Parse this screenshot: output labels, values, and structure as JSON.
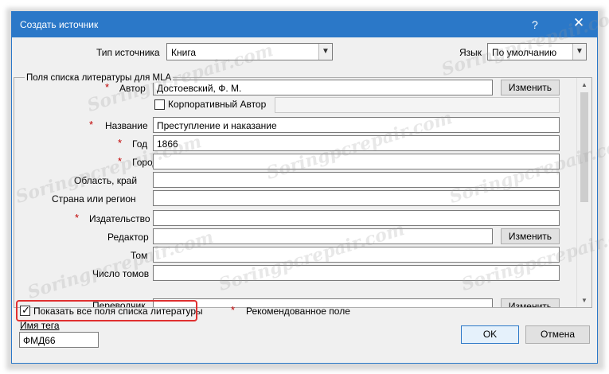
{
  "dialog": {
    "title": "Создать источник",
    "help": "?",
    "close": "✕"
  },
  "source_type": {
    "label": "Тип источника",
    "value": "Книга"
  },
  "language": {
    "label": "Язык",
    "value": "По умолчанию"
  },
  "group_title": "Поля списка литературы для MLA",
  "required_mark": "*",
  "fields": {
    "author": {
      "label": "Автор",
      "value": "Достоевский, Ф. М.",
      "button": "Изменить"
    },
    "corporate_author": {
      "label": "Корпоративный Автор",
      "value": ""
    },
    "title": {
      "label": "Название",
      "value": "Преступление и наказание"
    },
    "year": {
      "label": "Год",
      "value": "1866"
    },
    "city": {
      "label": "Город",
      "value": ""
    },
    "region": {
      "label": "Область, край",
      "value": ""
    },
    "country": {
      "label": "Страна или регион",
      "value": ""
    },
    "publisher": {
      "label": "Издательство",
      "value": ""
    },
    "editor": {
      "label": "Редактор",
      "value": "",
      "button": "Изменить"
    },
    "volume": {
      "label": "Том",
      "value": ""
    },
    "num_volumes": {
      "label": "Число томов",
      "value": ""
    },
    "translator": {
      "label": "Переводчик",
      "value": "",
      "button": "Изменить"
    }
  },
  "show_all": {
    "label": "Показать все поля списка литературы",
    "checked": true
  },
  "recommended": {
    "mark": "*",
    "label": "Рекомендованное поле"
  },
  "tag": {
    "label": "Имя тега",
    "value": "ФМД66"
  },
  "buttons": {
    "ok": "OK",
    "cancel": "Отмена"
  },
  "watermark": "Soringpcrepair.com",
  "colors": {
    "titlebar": "#2b78c8",
    "required": "#c00000",
    "highlight": "#e03030"
  }
}
